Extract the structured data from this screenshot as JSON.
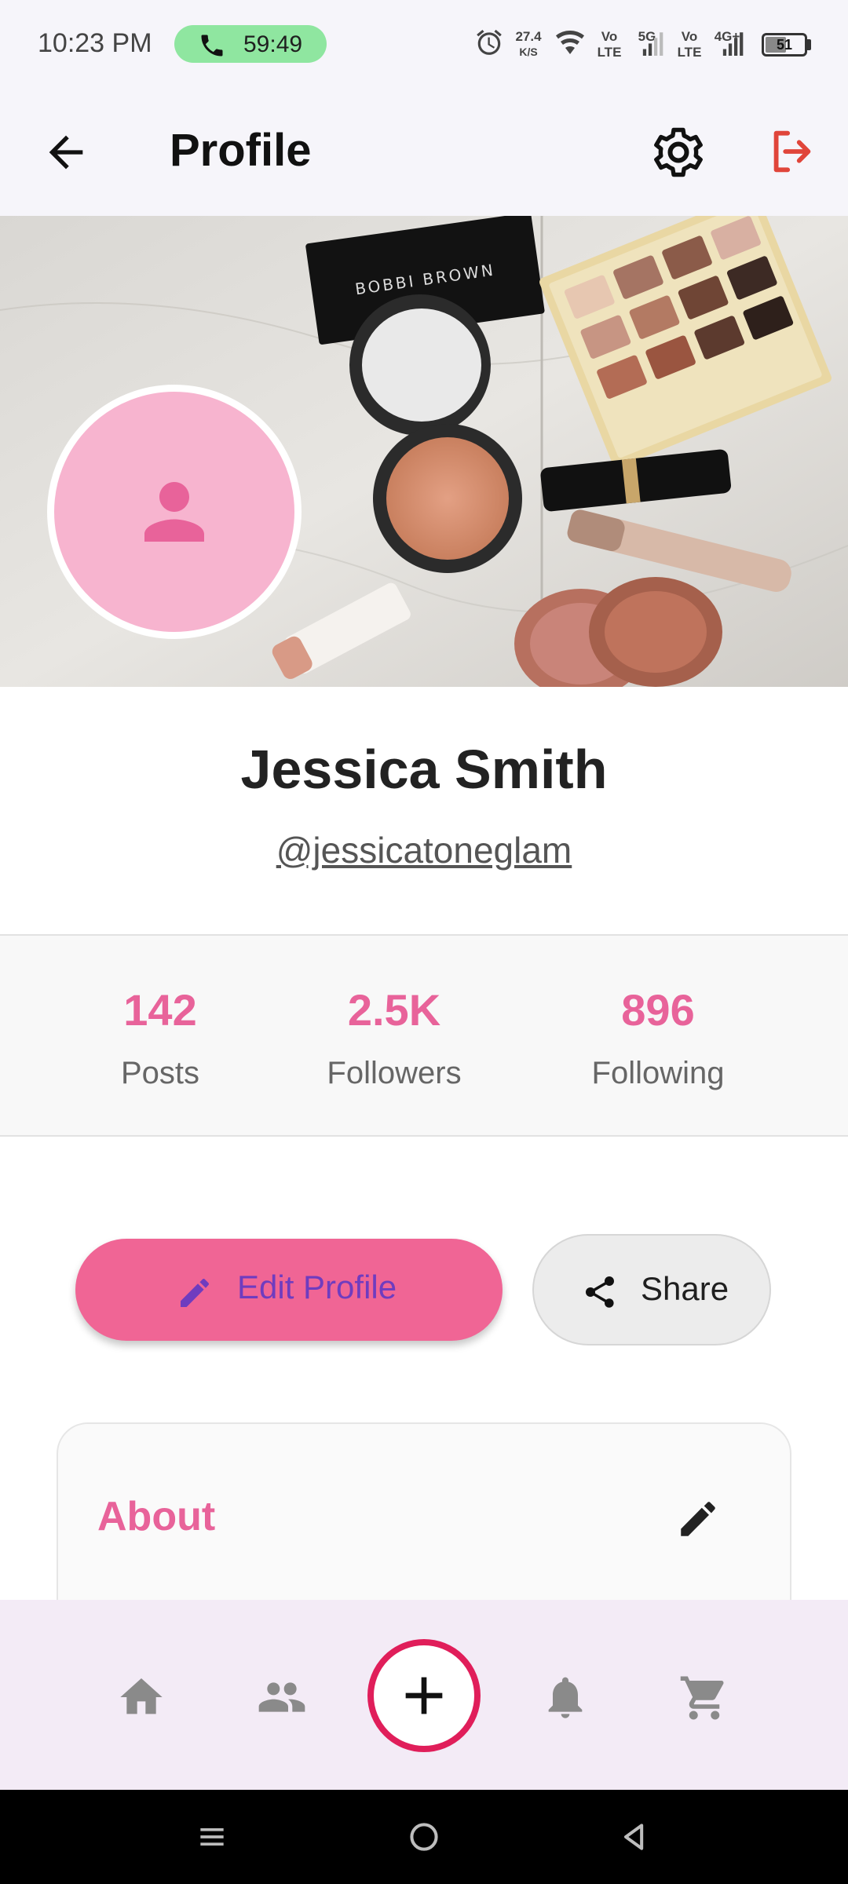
{
  "status_bar": {
    "time": "10:23 PM",
    "call_timer": "59:49",
    "net_speed": "27.4",
    "net_unit": "K/S",
    "volte1_top": "Vo",
    "volte1_bottom": "LTE",
    "sim1_type": "5G",
    "volte2_top": "Vo",
    "volte2_bottom": "LTE",
    "sim2_type": "4G+",
    "battery": "51"
  },
  "header": {
    "title": "Profile",
    "back_icon": "arrow-left-icon",
    "settings_icon": "gear-icon",
    "logout_icon": "logout-icon",
    "logout_color": "#e0453a"
  },
  "cover": {
    "palette_label": "BOBBI BROWN"
  },
  "profile": {
    "name": "Jessica Smith",
    "handle": "@jessicatoneglam",
    "avatar_color": "#f7b4cf",
    "avatar_icon_color": "#e8639a"
  },
  "stats": [
    {
      "value": "142",
      "label": "Posts"
    },
    {
      "value": "2.5K",
      "label": "Followers"
    },
    {
      "value": "896",
      "label": "Following"
    }
  ],
  "actions": {
    "edit_label": "Edit Profile",
    "share_label": "Share"
  },
  "about": {
    "title": "About"
  },
  "bottom_nav": {
    "items": [
      "home-icon",
      "people-icon",
      "add-icon",
      "bell-icon",
      "cart-icon"
    ],
    "active_accent": "#e01e5a"
  },
  "colors": {
    "accent": "#e8639a",
    "button": "#f06595",
    "button_text": "#6f3cbf"
  }
}
